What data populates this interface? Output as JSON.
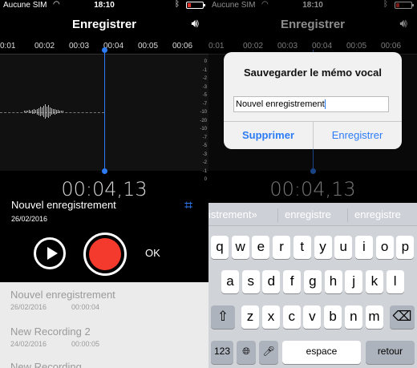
{
  "status": {
    "carrier": "Aucune SIM",
    "time": "18:10"
  },
  "left": {
    "title": "Enregistrer",
    "ruler_ticks": [
      "0:01",
      "00:02",
      "00:03",
      "00:04",
      "00:05",
      "00:06"
    ],
    "db_scale": [
      "0",
      "-1",
      "-2",
      "-3",
      "-5",
      "-7",
      "-10",
      "-20",
      "-10",
      "-7",
      "-5",
      "-3",
      "-2",
      "-1",
      "0"
    ],
    "elapsed": "00:04,13",
    "recording_name": "Nouvel enregistrement",
    "recording_date": "26/02/2016",
    "ok_label": "OK",
    "recordings": [
      {
        "name": "Nouvel enregistrement",
        "date": "26/02/2016",
        "duration": "00:00:04"
      },
      {
        "name": "New Recording 2",
        "date": "24/02/2016",
        "duration": "00:00:05"
      },
      {
        "name": "New Recording",
        "date": "",
        "duration": ""
      }
    ]
  },
  "right": {
    "title": "Enregistrer",
    "ruler_ticks": [
      "0:01",
      "00:02",
      "00:03",
      "00:04",
      "00:05",
      "00:06"
    ],
    "elapsed": "00:04,13",
    "dialog": {
      "title": "Sauvegarder le mémo vocal",
      "input_value": "Nouvel enregistrement",
      "delete_label": "Supprimer",
      "save_label": "Enregistrer"
    },
    "keyboard": {
      "suggestions": [
        "istrement»",
        "enregistre",
        "enregistre"
      ],
      "row1": [
        "q",
        "w",
        "e",
        "r",
        "t",
        "y",
        "u",
        "i",
        "o",
        "p"
      ],
      "row2": [
        "a",
        "s",
        "d",
        "f",
        "g",
        "h",
        "j",
        "k",
        "l"
      ],
      "row3": [
        "x",
        "c",
        "v",
        "b",
        "n",
        "m"
      ],
      "first_row3_letter": "z",
      "numbers_label": "123",
      "space_label": "espace",
      "return_label": "retour"
    }
  }
}
